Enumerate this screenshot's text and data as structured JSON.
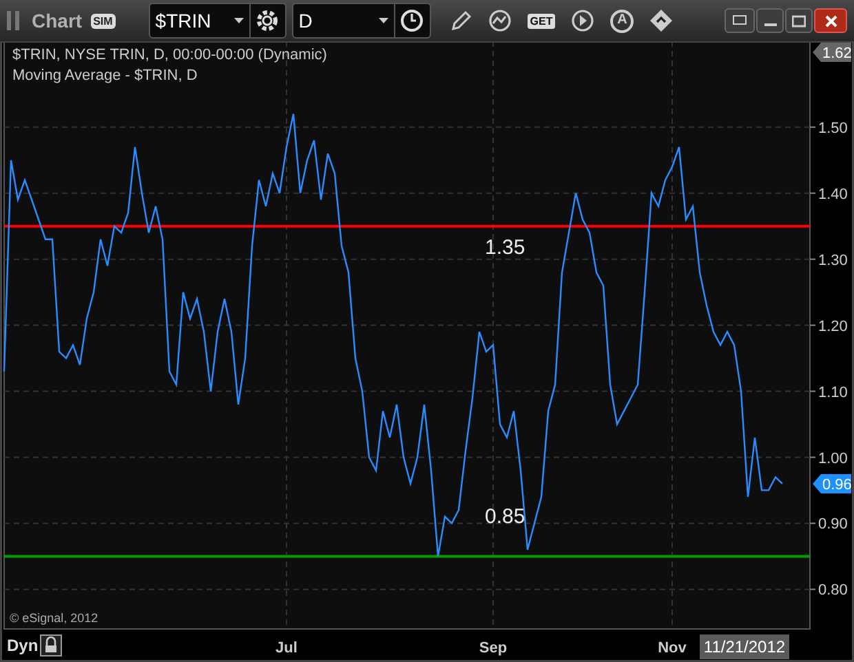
{
  "toolbar": {
    "title": "Chart",
    "badge": "SIM",
    "symbol": "$TRIN",
    "interval": "D",
    "get_label": "GET",
    "a_label": "A"
  },
  "chart": {
    "legend": [
      "$TRIN, NYSE TRIN, D, 00:00-00:00 (Dynamic)",
      "Moving Average - $TRIN, D"
    ],
    "copyright": "© eSignal, 2012",
    "price_tags": [
      {
        "kind": "high",
        "label": "1.62"
      },
      {
        "kind": "last",
        "label": "0.96"
      }
    ],
    "chart_data": {
      "type": "line",
      "grid": true,
      "ylim": [
        0.74,
        1.63
      ],
      "categories": [
        null,
        null,
        null,
        null,
        null,
        null,
        null,
        null,
        null,
        null,
        null,
        null,
        null,
        null,
        null,
        null,
        null,
        null,
        null,
        null,
        null,
        null,
        null,
        null,
        null,
        null,
        null,
        null,
        null,
        null,
        null,
        null,
        null,
        null,
        null,
        null,
        null,
        null,
        null,
        null,
        null,
        "Jul",
        null,
        null,
        null,
        null,
        null,
        null,
        null,
        null,
        null,
        null,
        null,
        null,
        null,
        null,
        null,
        null,
        null,
        null,
        null,
        null,
        null,
        null,
        null,
        null,
        null,
        null,
        null,
        null,
        null,
        "Sep",
        null,
        null,
        null,
        null,
        null,
        null,
        null,
        null,
        null,
        null,
        null,
        null,
        null,
        null,
        null,
        null,
        null,
        null,
        null,
        null,
        null,
        null,
        null,
        null,
        null,
        "Nov",
        null,
        null,
        null,
        null,
        null,
        null,
        null,
        null,
        null,
        null,
        null,
        null,
        null,
        null,
        null,
        null
      ],
      "yticks": [
        {
          "value": 0.8,
          "label": "0.80"
        },
        {
          "value": 0.9,
          "label": "0.90"
        },
        {
          "value": 1.0,
          "label": "1.00"
        },
        {
          "value": 1.1,
          "label": "1.10"
        },
        {
          "value": 1.2,
          "label": "1.20"
        },
        {
          "value": 1.3,
          "label": "1.30"
        },
        {
          "value": 1.4,
          "label": "1.40"
        },
        {
          "value": 1.5,
          "label": "1.50"
        }
      ],
      "series": [
        {
          "color": "#2a8cff",
          "values": [
            1.13,
            1.45,
            1.39,
            1.42,
            1.39,
            1.36,
            1.33,
            1.33,
            1.16,
            1.15,
            1.17,
            1.14,
            1.21,
            1.25,
            1.33,
            1.29,
            1.35,
            1.34,
            1.37,
            1.47,
            1.4,
            1.34,
            1.38,
            1.33,
            1.13,
            1.11,
            1.25,
            1.21,
            1.24,
            1.19,
            1.1,
            1.19,
            1.24,
            1.19,
            1.08,
            1.15,
            1.32,
            1.42,
            1.38,
            1.43,
            1.4,
            1.47,
            1.52,
            1.4,
            1.45,
            1.48,
            1.39,
            1.46,
            1.43,
            1.32,
            1.28,
            1.15,
            1.1,
            1.0,
            0.98,
            1.07,
            1.03,
            1.08,
            1.0,
            0.96,
            1.0,
            1.08,
            0.98,
            0.85,
            0.91,
            0.9,
            0.92,
            1.01,
            1.09,
            1.19,
            1.16,
            1.17,
            1.05,
            1.03,
            1.07,
            0.98,
            0.86,
            0.9,
            0.94,
            1.07,
            1.11,
            1.28,
            1.34,
            1.4,
            1.36,
            1.34,
            1.28,
            1.26,
            1.11,
            1.05,
            1.07,
            1.09,
            1.11,
            1.25,
            1.4,
            1.38,
            1.42,
            1.44,
            1.47,
            1.36,
            1.38,
            1.28,
            1.23,
            1.19,
            1.17,
            1.19,
            1.17,
            1.1,
            0.94,
            1.03,
            0.95,
            0.95,
            0.97,
            0.96
          ]
        }
      ],
      "ref_lines": [
        {
          "axis": "y",
          "value": 1.35,
          "label": "1.35",
          "color": "#ff0000"
        },
        {
          "axis": "y",
          "value": 0.85,
          "label": "0.85",
          "color": "#00a000"
        }
      ]
    }
  },
  "footer": {
    "mode": "Dyn",
    "date": "11/21/2012"
  }
}
